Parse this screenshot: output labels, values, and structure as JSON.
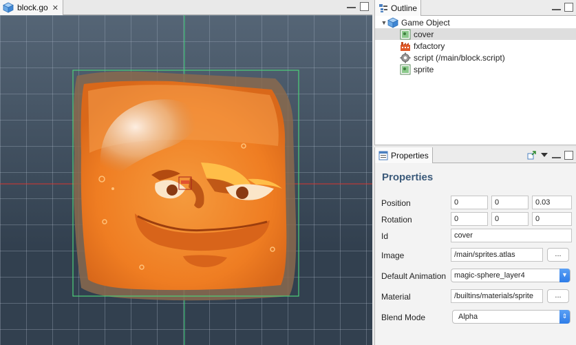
{
  "editor": {
    "tab_label": "block.go",
    "tab_close": "✕"
  },
  "outline": {
    "tab_label": "Outline",
    "root": {
      "label": "Game Object",
      "expanded": true
    },
    "items": [
      {
        "label": "cover",
        "icon": "sprite-icon",
        "selected": true
      },
      {
        "label": "fxfactory",
        "icon": "factory-icon",
        "selected": false
      },
      {
        "label": "script (/main/block.script)",
        "icon": "gear-icon",
        "selected": false
      },
      {
        "label": "sprite",
        "icon": "sprite-icon",
        "selected": false
      }
    ]
  },
  "properties": {
    "tab_label": "Properties",
    "title": "Properties",
    "position": {
      "label": "Position",
      "x": "0",
      "y": "0",
      "z": "0.03"
    },
    "rotation": {
      "label": "Rotation",
      "x": "0",
      "y": "0",
      "z": "0"
    },
    "id": {
      "label": "Id",
      "value": "cover"
    },
    "image": {
      "label": "Image",
      "value": "/main/sprites.atlas",
      "button": "..."
    },
    "default_animation": {
      "label": "Default Animation",
      "value": "magic-sphere_layer4"
    },
    "material": {
      "label": "Material",
      "value": "/builtins/materials/sprite",
      "button": "..."
    },
    "blend_mode": {
      "label": "Blend Mode",
      "value": "Alpha"
    }
  },
  "colors": {
    "accent": "#2f7de8",
    "title": "#3b5a7a",
    "block_orange": "#f28a2e",
    "selection_box": "#4dd17a",
    "axis_green": "#3ed07a",
    "axis_red": "#d9362e"
  }
}
